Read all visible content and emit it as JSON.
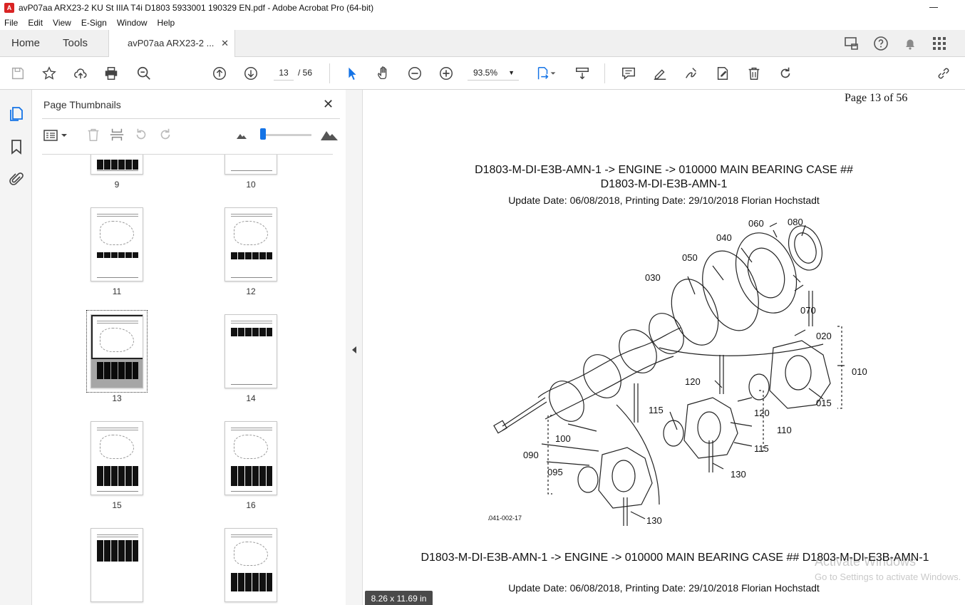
{
  "window": {
    "title": "avP07aa ARX23-2 KU St IIIA T4i D1803 5933001 190329 EN.pdf - Adobe Acrobat Pro (64-bit)",
    "app_icon_glyph": "A"
  },
  "menu": [
    "File",
    "Edit",
    "View",
    "E-Sign",
    "Window",
    "Help"
  ],
  "tabs": {
    "home": "Home",
    "tools": "Tools",
    "document": "avP07aa ARX23-2 ...",
    "close_glyph": "✕"
  },
  "toolbar": {
    "current_page": "13",
    "total_pages": "/ 56",
    "zoom": "93.5%",
    "zoom_caret": "▼"
  },
  "panel": {
    "title": "Page Thumbnails",
    "close_glyph": "✕",
    "scroll_up_glyph": "▲",
    "thumbnails": [
      {
        "label": "9"
      },
      {
        "label": "10"
      },
      {
        "label": "11"
      },
      {
        "label": "12"
      },
      {
        "label": "13"
      },
      {
        "label": "14"
      },
      {
        "label": "15"
      },
      {
        "label": "16"
      },
      {
        "label": ""
      },
      {
        "label": ""
      }
    ],
    "selected_page": "13"
  },
  "document": {
    "page_indicator": "Page 13 of 56",
    "heading_top_line1": "D1803-M-DI-E3B-AMN-1 -> ENGINE -> 010000 MAIN BEARING CASE ##",
    "heading_top_line2": "D1803-M-DI-E3B-AMN-1",
    "update_top": "Update Date: 06/08/2018, Printing Date: 29/10/2018 Florian Hochstadt",
    "heading_bottom": "D1803-M-DI-E3B-AMN-1 -> ENGINE -> 010000 MAIN BEARING CASE ## D1803-M-DI-E3B-AMN-1",
    "update_bottom": "Update Date: 06/08/2018, Printing Date: 29/10/2018 Florian Hochstadt",
    "diagram_labels": {
      "l060": "060",
      "l080": "080",
      "l040": "040",
      "l050": "050",
      "l030": "030",
      "l070": "070",
      "l020": "020",
      "l010": "010",
      "l015": "015",
      "l120a": "120",
      "l120b": "120",
      "l115a": "115",
      "l115b": "115",
      "l110": "110",
      "l100": "100",
      "l090": "090",
      "l095": "095",
      "l130a": "130",
      "l130b": "130",
      "code": "1A041-002-17"
    },
    "page_size": "8.26 x 11.69 in"
  },
  "watermark": {
    "line1": "Activate Windows",
    "line2": "Go to Settings to activate Windows."
  }
}
